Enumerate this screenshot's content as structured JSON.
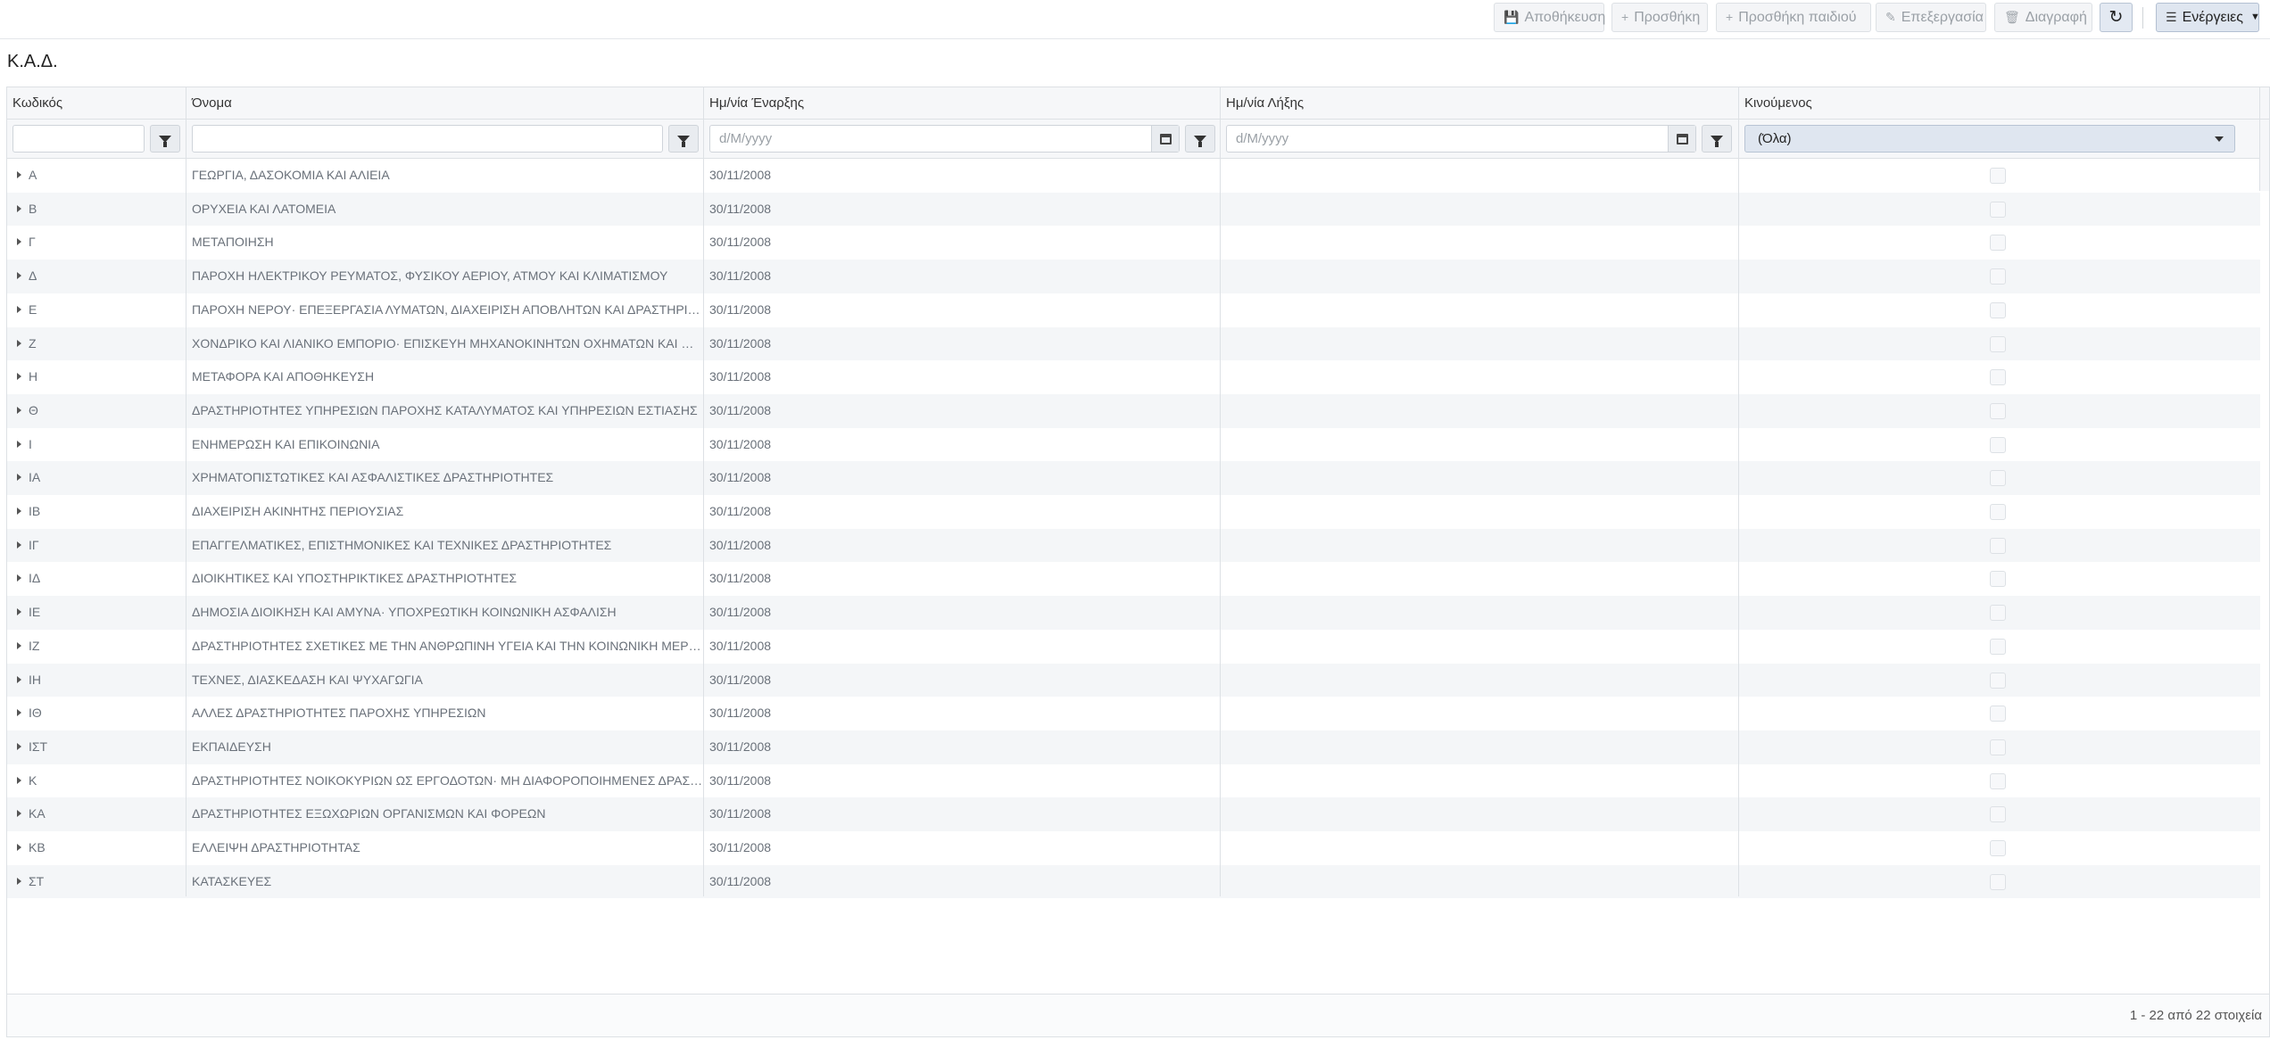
{
  "toolbar": {
    "save_label": "Αποθήκευση",
    "add_label": "Προσθήκη",
    "add_child_label": "Προσθήκη παιδιού",
    "edit_label": "Επεξεργασία",
    "delete_label": "Διαγραφή",
    "refresh_icon": "refresh-icon",
    "actions_label": "Ενέργειες"
  },
  "page": {
    "title": "Κ.Α.Δ."
  },
  "grid": {
    "columns": [
      "Κωδικός",
      "Όνομα",
      "Ημ/νία Έναρξης",
      "Ημ/νία Λήξης",
      "Κινούμενος"
    ],
    "filters": {
      "code_value": "",
      "name_value": "",
      "start_placeholder": "d/M/yyyy",
      "end_placeholder": "d/M/yyyy",
      "moving_selected": "(Όλα)"
    },
    "rows": [
      {
        "code": "Α",
        "name": "ΓΕΩΡΓΙΑ, ΔΑΣΟΚΟΜΙΑ ΚΑΙ ΑΛΙΕΙΑ",
        "start": "30/11/2008",
        "end": ""
      },
      {
        "code": "Β",
        "name": "ΟΡΥΧΕΙΑ ΚΑΙ ΛΑΤΟΜΕΙΑ",
        "start": "30/11/2008",
        "end": ""
      },
      {
        "code": "Γ",
        "name": "ΜΕΤΑΠΟΙΗΣΗ",
        "start": "30/11/2008",
        "end": ""
      },
      {
        "code": "Δ",
        "name": "ΠΑΡΟΧΗ ΗΛΕΚΤΡΙΚΟΥ ΡΕΥΜΑΤΟΣ, ΦΥΣΙΚΟΥ ΑΕΡΙΟΥ, ΑΤΜΟΥ ΚΑΙ ΚΛΙΜΑΤΙΣΜΟΥ",
        "start": "30/11/2008",
        "end": ""
      },
      {
        "code": "Ε",
        "name": "ΠΑΡΟΧΗ ΝΕΡΟΥ· ΕΠΕΞΕΡΓΑΣΙΑ ΛΥΜΑΤΩΝ, ΔΙΑΧΕΙΡΙΣΗ ΑΠΟΒΛΗΤΩΝ ΚΑΙ ΔΡΑΣΤΗΡΙΟΤ...",
        "start": "30/11/2008",
        "end": ""
      },
      {
        "code": "Ζ",
        "name": "ΧΟΝΔΡΙΚΟ ΚΑΙ ΛΙΑΝΙΚΟ ΕΜΠΟΡΙΟ· ΕΠΙΣΚΕΥΗ ΜΗΧΑΝΟΚΙΝΗΤΩΝ ΟΧΗΜΑΤΩΝ ΚΑΙ ΜΟ...",
        "start": "30/11/2008",
        "end": ""
      },
      {
        "code": "Η",
        "name": "ΜΕΤΑΦΟΡΑ ΚΑΙ ΑΠΟΘΗΚΕΥΣΗ",
        "start": "30/11/2008",
        "end": ""
      },
      {
        "code": "Θ",
        "name": "ΔΡΑΣΤΗΡΙΟΤΗΤΕΣ ΥΠΗΡΕΣΙΩΝ ΠΑΡΟΧΗΣ ΚΑΤΑΛΥΜΑΤΟΣ ΚΑΙ ΥΠΗΡΕΣΙΩΝ ΕΣΤΙΑΣΗΣ",
        "start": "30/11/2008",
        "end": ""
      },
      {
        "code": "Ι",
        "name": "ΕΝΗΜΕΡΩΣΗ ΚΑΙ ΕΠΙΚΟΙΝΩΝΙΑ",
        "start": "30/11/2008",
        "end": ""
      },
      {
        "code": "ΙΑ",
        "name": "ΧΡΗΜΑΤΟΠΙΣΤΩΤΙΚΕΣ ΚΑΙ ΑΣΦΑΛΙΣΤΙΚΕΣ ΔΡΑΣΤΗΡΙΟΤΗΤΕΣ",
        "start": "30/11/2008",
        "end": ""
      },
      {
        "code": "ΙΒ",
        "name": "ΔΙΑΧΕΙΡΙΣΗ ΑΚΙΝΗΤΗΣ ΠΕΡΙΟΥΣΙΑΣ",
        "start": "30/11/2008",
        "end": ""
      },
      {
        "code": "ΙΓ",
        "name": "ΕΠΑΓΓΕΛΜΑΤΙΚΕΣ, ΕΠΙΣΤΗΜΟΝΙΚΕΣ ΚΑΙ ΤΕΧΝΙΚΕΣ ΔΡΑΣΤΗΡΙΟΤΗΤΕΣ",
        "start": "30/11/2008",
        "end": ""
      },
      {
        "code": "ΙΔ",
        "name": "ΔΙΟΙΚΗΤΙΚΕΣ ΚΑΙ ΥΠΟΣΤΗΡΙΚΤΙΚΕΣ ΔΡΑΣΤΗΡΙΟΤΗΤΕΣ",
        "start": "30/11/2008",
        "end": ""
      },
      {
        "code": "ΙΕ",
        "name": "ΔΗΜΟΣΙΑ ΔΙΟΙΚΗΣΗ ΚΑΙ ΑΜΥΝΑ· ΥΠΟΧΡΕΩΤΙΚΗ ΚΟΙΝΩΝΙΚΗ ΑΣΦΑΛΙΣΗ",
        "start": "30/11/2008",
        "end": ""
      },
      {
        "code": "ΙΖ",
        "name": "ΔΡΑΣΤΗΡΙΟΤΗΤΕΣ ΣΧΕΤΙΚΕΣ ΜΕ ΤΗΝ ΑΝΘΡΩΠΙΝΗ ΥΓΕΙΑ ΚΑΙ ΤΗΝ ΚΟΙΝΩΝΙΚΗ ΜΕΡΙΜ...",
        "start": "30/11/2008",
        "end": ""
      },
      {
        "code": "ΙΗ",
        "name": "ΤΕΧΝΕΣ, ΔΙΑΣΚΕΔΑΣΗ ΚΑΙ ΨΥΧΑΓΩΓΙΑ",
        "start": "30/11/2008",
        "end": ""
      },
      {
        "code": "ΙΘ",
        "name": "ΑΛΛΕΣ ΔΡΑΣΤΗΡΙΟΤΗΤΕΣ ΠΑΡΟΧΗΣ ΥΠΗΡΕΣΙΩΝ",
        "start": "30/11/2008",
        "end": ""
      },
      {
        "code": "ΙΣΤ",
        "name": "ΕΚΠΑΙΔΕΥΣΗ",
        "start": "30/11/2008",
        "end": ""
      },
      {
        "code": "Κ",
        "name": "ΔΡΑΣΤΗΡΙΟΤΗΤΕΣ ΝΟΙΚΟΚΥΡΙΩΝ ΩΣ ΕΡΓΟΔΟΤΩΝ· ΜΗ ΔΙΑΦΟΡΟΠΟΙΗΜΕΝΕΣ ΔΡΑΣΤΗ...",
        "start": "30/11/2008",
        "end": ""
      },
      {
        "code": "ΚΑ",
        "name": "ΔΡΑΣΤΗΡΙΟΤΗΤΕΣ ΕΞΩΧΩΡΙΩΝ ΟΡΓΑΝΙΣΜΩΝ ΚΑΙ ΦΟΡΕΩΝ",
        "start": "30/11/2008",
        "end": ""
      },
      {
        "code": "ΚΒ",
        "name": "ΕΛΛΕΙΨΗ ΔΡΑΣΤΗΡΙΟΤΗΤΑΣ",
        "start": "30/11/2008",
        "end": ""
      },
      {
        "code": "ΣΤ",
        "name": "ΚΑΤΑΣΚΕΥΕΣ",
        "start": "30/11/2008",
        "end": ""
      }
    ],
    "pager_text": "1 - 22 από 22 στοιχεία"
  }
}
